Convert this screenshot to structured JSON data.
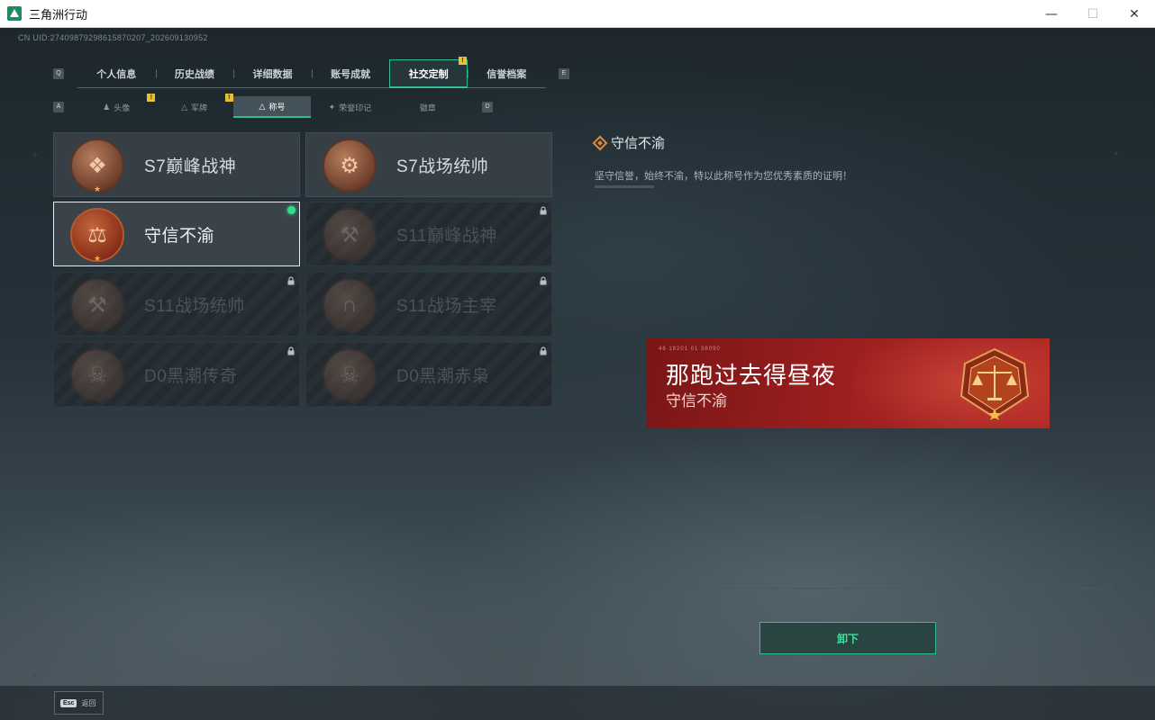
{
  "window": {
    "title": "三角洲行动",
    "minimize": "—",
    "maximize": "☐",
    "close": "✕"
  },
  "uid": "CN UID:27409879298615870207_202609130952",
  "main_tabs": {
    "prev_key": "Q",
    "next_key": "E",
    "items": [
      {
        "label": "个人信息"
      },
      {
        "label": "历史战绩"
      },
      {
        "label": "详细数据"
      },
      {
        "label": "账号成就"
      },
      {
        "label": "社交定制"
      },
      {
        "label": "信誉档案"
      }
    ],
    "active_index": 4
  },
  "sub_tabs": {
    "prev_key": "A",
    "next_key": "D",
    "items": [
      {
        "label": "头像",
        "icon": "person-icon"
      },
      {
        "label": "军牌",
        "icon": "dogtag-icon"
      },
      {
        "label": "称号",
        "icon": "title-icon"
      },
      {
        "label": "荣誉印记",
        "icon": "honor-icon"
      },
      {
        "label": "徽章",
        "icon": ""
      }
    ],
    "active_index": 2
  },
  "titles": [
    {
      "name": "S7巅峰战神",
      "emblem": "rifle-icon",
      "state": "unlocked"
    },
    {
      "name": "S7战场统帅",
      "emblem": "vehicle-icon",
      "state": "unlocked"
    },
    {
      "name": "守信不渝",
      "emblem": "scales-icon",
      "state": "selected"
    },
    {
      "name": "S11巅峰战神",
      "emblem": "tank-icon",
      "state": "locked"
    },
    {
      "name": "S11战场统帅",
      "emblem": "armored-vehicle-icon",
      "state": "locked"
    },
    {
      "name": "S11战场主宰",
      "emblem": "arch-icon",
      "state": "locked"
    },
    {
      "name": "D0黑潮传奇",
      "emblem": "masked-head-icon",
      "state": "locked"
    },
    {
      "name": "D0黑潮赤枭",
      "emblem": "skull-icon",
      "state": "locked"
    }
  ],
  "detail": {
    "title": "守信不渝",
    "description": "坚守信誉，始终不渝，特以此称号作为您优秀素质的证明！"
  },
  "banner": {
    "player_name": "那跑过去得昼夜",
    "title": "守信不渝",
    "code": "46 18201  01 38090"
  },
  "unequip_label": "卸下",
  "bottom": {
    "esc_key": "Esc",
    "back_label": "返回"
  },
  "colors": {
    "accent": "#2fbf8c",
    "badge": "#e7c03a",
    "banner_red": "#9c1f1f"
  }
}
